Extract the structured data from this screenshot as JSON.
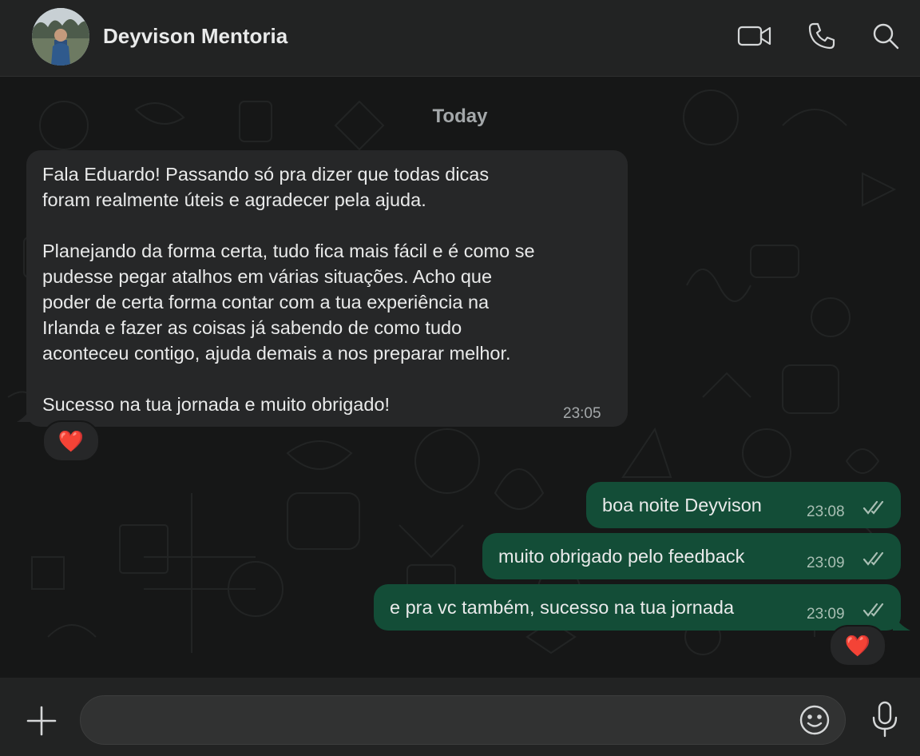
{
  "header": {
    "contact_name": "Deyvison Mentoria",
    "icons": [
      "avatar",
      "video-call-icon",
      "voice-call-icon",
      "search-icon"
    ]
  },
  "chat": {
    "date_label": "Today",
    "messages": [
      {
        "direction": "incoming",
        "text": "Fala Eduardo! Passando só pra dizer que todas dicas\nforam realmente úteis e agradecer pela ajuda.\n\nPlanejando da forma certa, tudo fica mais fácil e é como se\npudesse pegar atalhos em várias situações. Acho que\npoder de certa forma contar com a tua experiência na\nIrlanda e fazer as coisas já sabendo de como tudo\naconteceu contigo, ajuda demais a nos preparar melhor.\n\nSucesso na tua jornada e muito obrigado!",
        "time": "23:05",
        "reaction": "❤️"
      },
      {
        "direction": "outgoing",
        "text": "boa noite Deyvison",
        "time": "23:08",
        "status": "read"
      },
      {
        "direction": "outgoing",
        "text": "muito obrigado pelo feedback",
        "time": "23:09",
        "status": "read"
      },
      {
        "direction": "outgoing",
        "text": "e pra vc também, sucesso na tua jornada",
        "time": "23:09",
        "status": "read",
        "reaction": "❤️"
      }
    ]
  },
  "composer": {
    "placeholder": "",
    "icons": [
      "plus-icon",
      "emoji-icon",
      "microphone-icon"
    ]
  },
  "colors": {
    "background": "#161717",
    "header": "#222323",
    "incoming_bubble": "#262728",
    "outgoing_bubble": "#134d37",
    "text": "#e9eaea",
    "muted": "#a4a8aa"
  }
}
